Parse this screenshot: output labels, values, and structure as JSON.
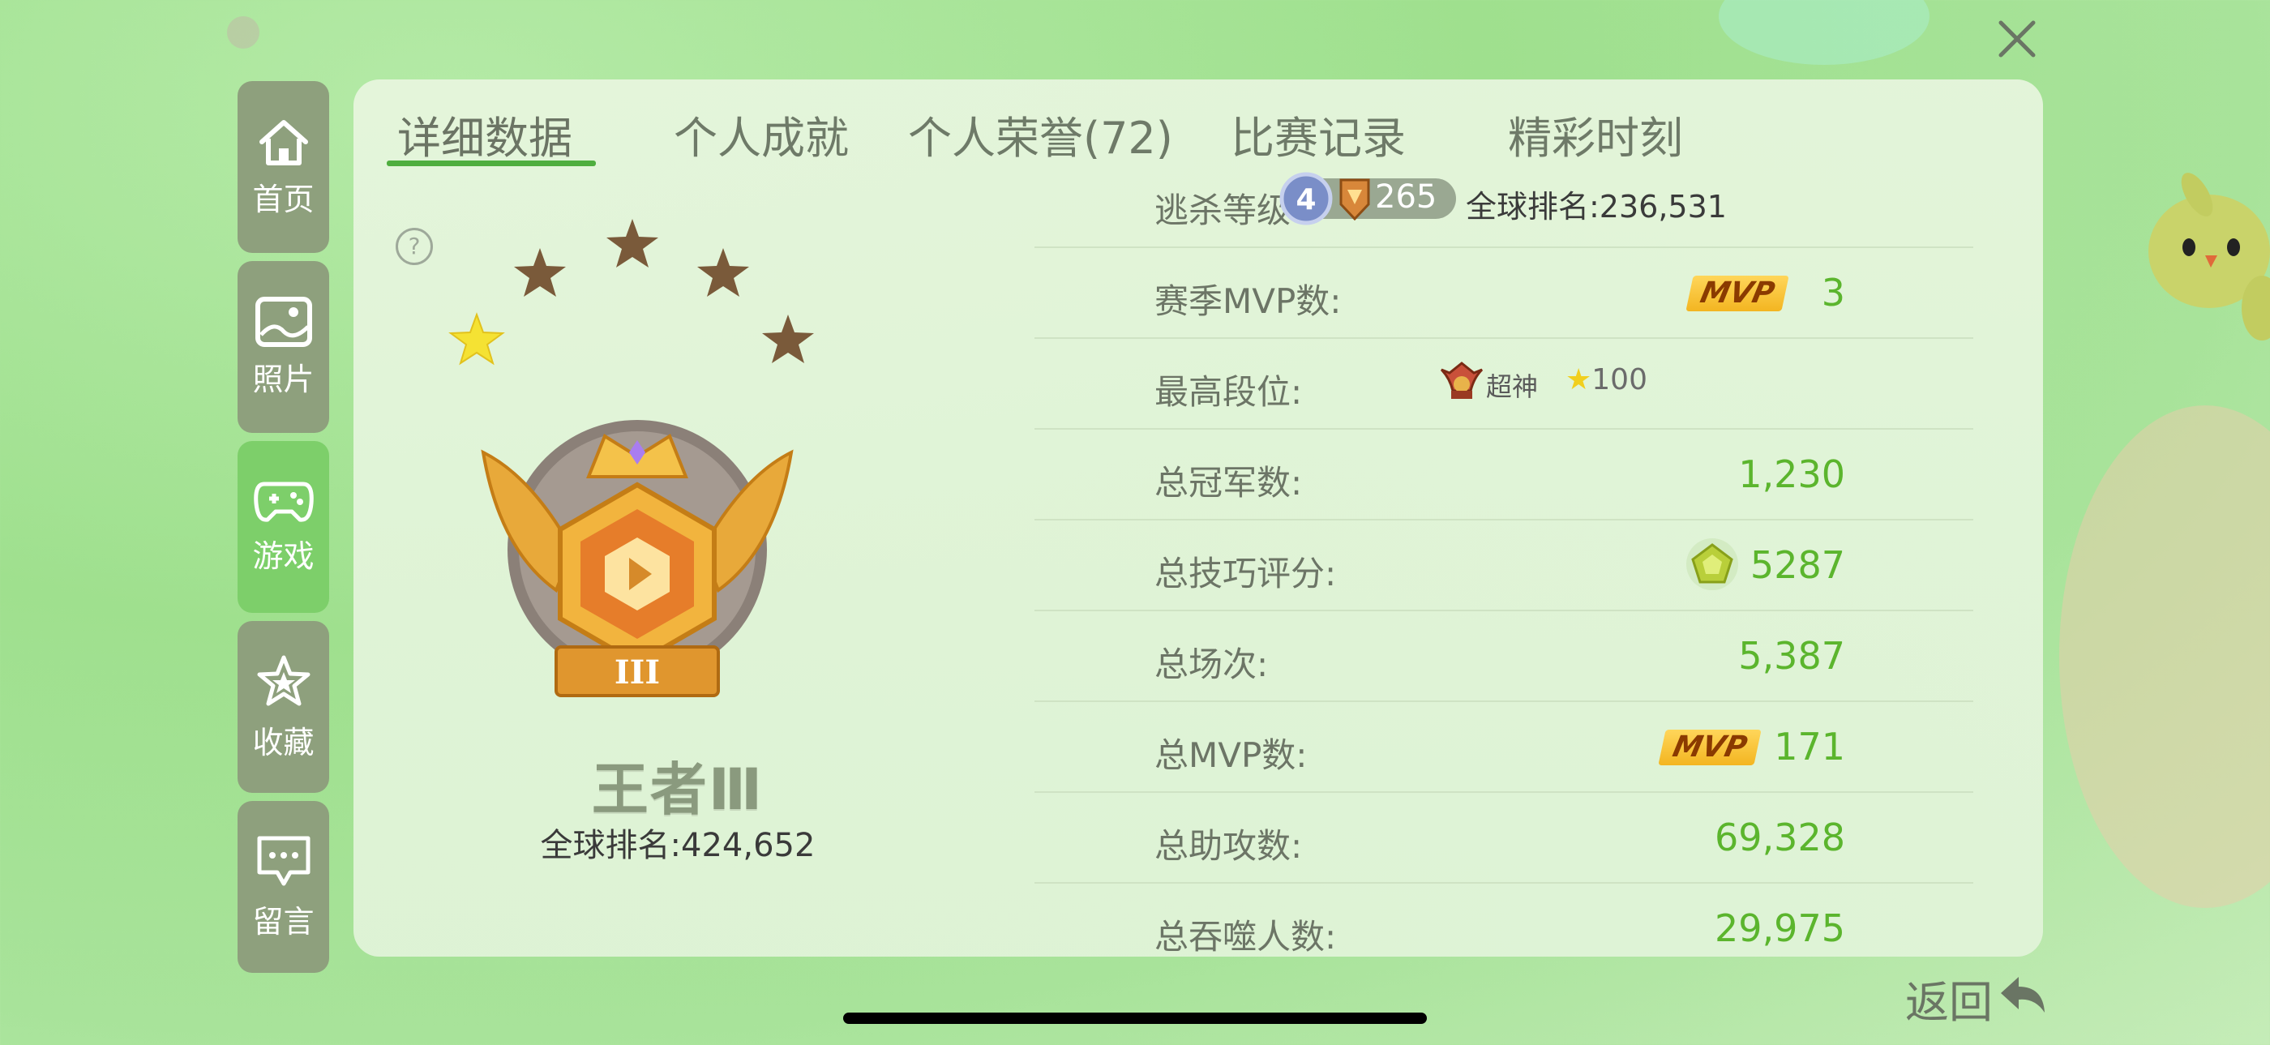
{
  "tabs": [
    {
      "label": "详细数据",
      "active": true
    },
    {
      "label": "个人成就",
      "active": false
    },
    {
      "label": "个人荣誉(72)",
      "active": false
    },
    {
      "label": "比赛记录",
      "active": false
    },
    {
      "label": "精彩时刻",
      "active": false
    }
  ],
  "side_nav": [
    {
      "label": "首页",
      "icon": "home-icon",
      "active": false
    },
    {
      "label": "照片",
      "icon": "photo-icon",
      "active": false
    },
    {
      "label": "游戏",
      "icon": "gamepad-icon",
      "active": true
    },
    {
      "label": "收藏",
      "icon": "star-icon",
      "active": false
    },
    {
      "label": "留言",
      "icon": "message-icon",
      "active": false
    }
  ],
  "rank": {
    "name": "王者Ⅲ",
    "global_rank": "全球排名:424,652",
    "badge_numeral": "III",
    "stars_filled": 1,
    "stars_total": 5,
    "help": "?"
  },
  "stats": {
    "escape_kill_level": {
      "label": "逃杀等级:",
      "level_badge": "4",
      "level": "265",
      "global_rank": "全球排名:236,531"
    },
    "season_mvp": {
      "label": "赛季MVP数:",
      "tag": "MVP",
      "value": "3"
    },
    "highest_tier": {
      "label": "最高段位:",
      "tier": "超神",
      "star_icon": "★",
      "stars": "100"
    },
    "total_champions": {
      "label": "总冠军数:",
      "value": "1,230"
    },
    "total_skill_score": {
      "label": "总技巧评分:",
      "value": "5287"
    },
    "total_games": {
      "label": "总场次:",
      "value": "5,387"
    },
    "total_mvp": {
      "label": "总MVP数:",
      "tag": "MVP",
      "value": "171"
    },
    "total_assists": {
      "label": "总助攻数:",
      "value": "69,328"
    },
    "total_devoured": {
      "label": "总吞噬人数:",
      "value": "29,975"
    }
  },
  "back_label": "返回",
  "colors": {
    "accent": "#5bb52d",
    "nav_active": "#7dcf6a",
    "nav": "#8ea07d",
    "mvp": "#f3b521"
  }
}
